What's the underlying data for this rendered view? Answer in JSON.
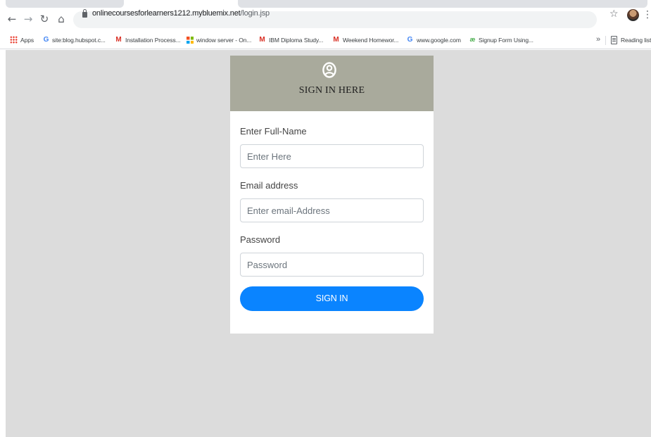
{
  "browser": {
    "url_host": "onlinecoursesforlearners1212.mybluemix.net",
    "url_path": "/login.jsp",
    "icons": {
      "back": "back-arrow-icon",
      "forward": "forward-arrow-icon",
      "reload": "reload-icon",
      "home": "home-icon",
      "lock": "lock-icon",
      "star": "star-icon",
      "menu": "kebab-menu-icon"
    }
  },
  "bookmarks": {
    "items": [
      {
        "label": "Apps",
        "icon": "apps-grid-icon"
      },
      {
        "label": "site:blog.hubspot.c...",
        "icon": "google-icon"
      },
      {
        "label": "Installation Process...",
        "icon": "gmail-icon"
      },
      {
        "label": "window server - On...",
        "icon": "microsoft-icon"
      },
      {
        "label": "IBM Diploma Study...",
        "icon": "gmail-icon"
      },
      {
        "label": "Weekend Homewor...",
        "icon": "gmail-icon"
      },
      {
        "label": "www.google.com",
        "icon": "google-icon"
      },
      {
        "label": "Signup Form Using...",
        "icon": "w3schools-icon"
      }
    ],
    "overflow": "»",
    "reading_list": "Reading list"
  },
  "card": {
    "header_title": "SIGN IN HERE",
    "header_icon": "user-circle-icon",
    "header_color": "#a9aa9c",
    "fields": {
      "fullname": {
        "label": "Enter Full-Name",
        "placeholder": "Enter Here"
      },
      "email": {
        "label": "Email address",
        "placeholder": "Enter email-Address"
      },
      "password": {
        "label": "Password",
        "placeholder": "Password"
      }
    },
    "submit_label": "SIGN IN",
    "submit_color": "#0a84ff"
  },
  "page_background": "#dcdcdc"
}
